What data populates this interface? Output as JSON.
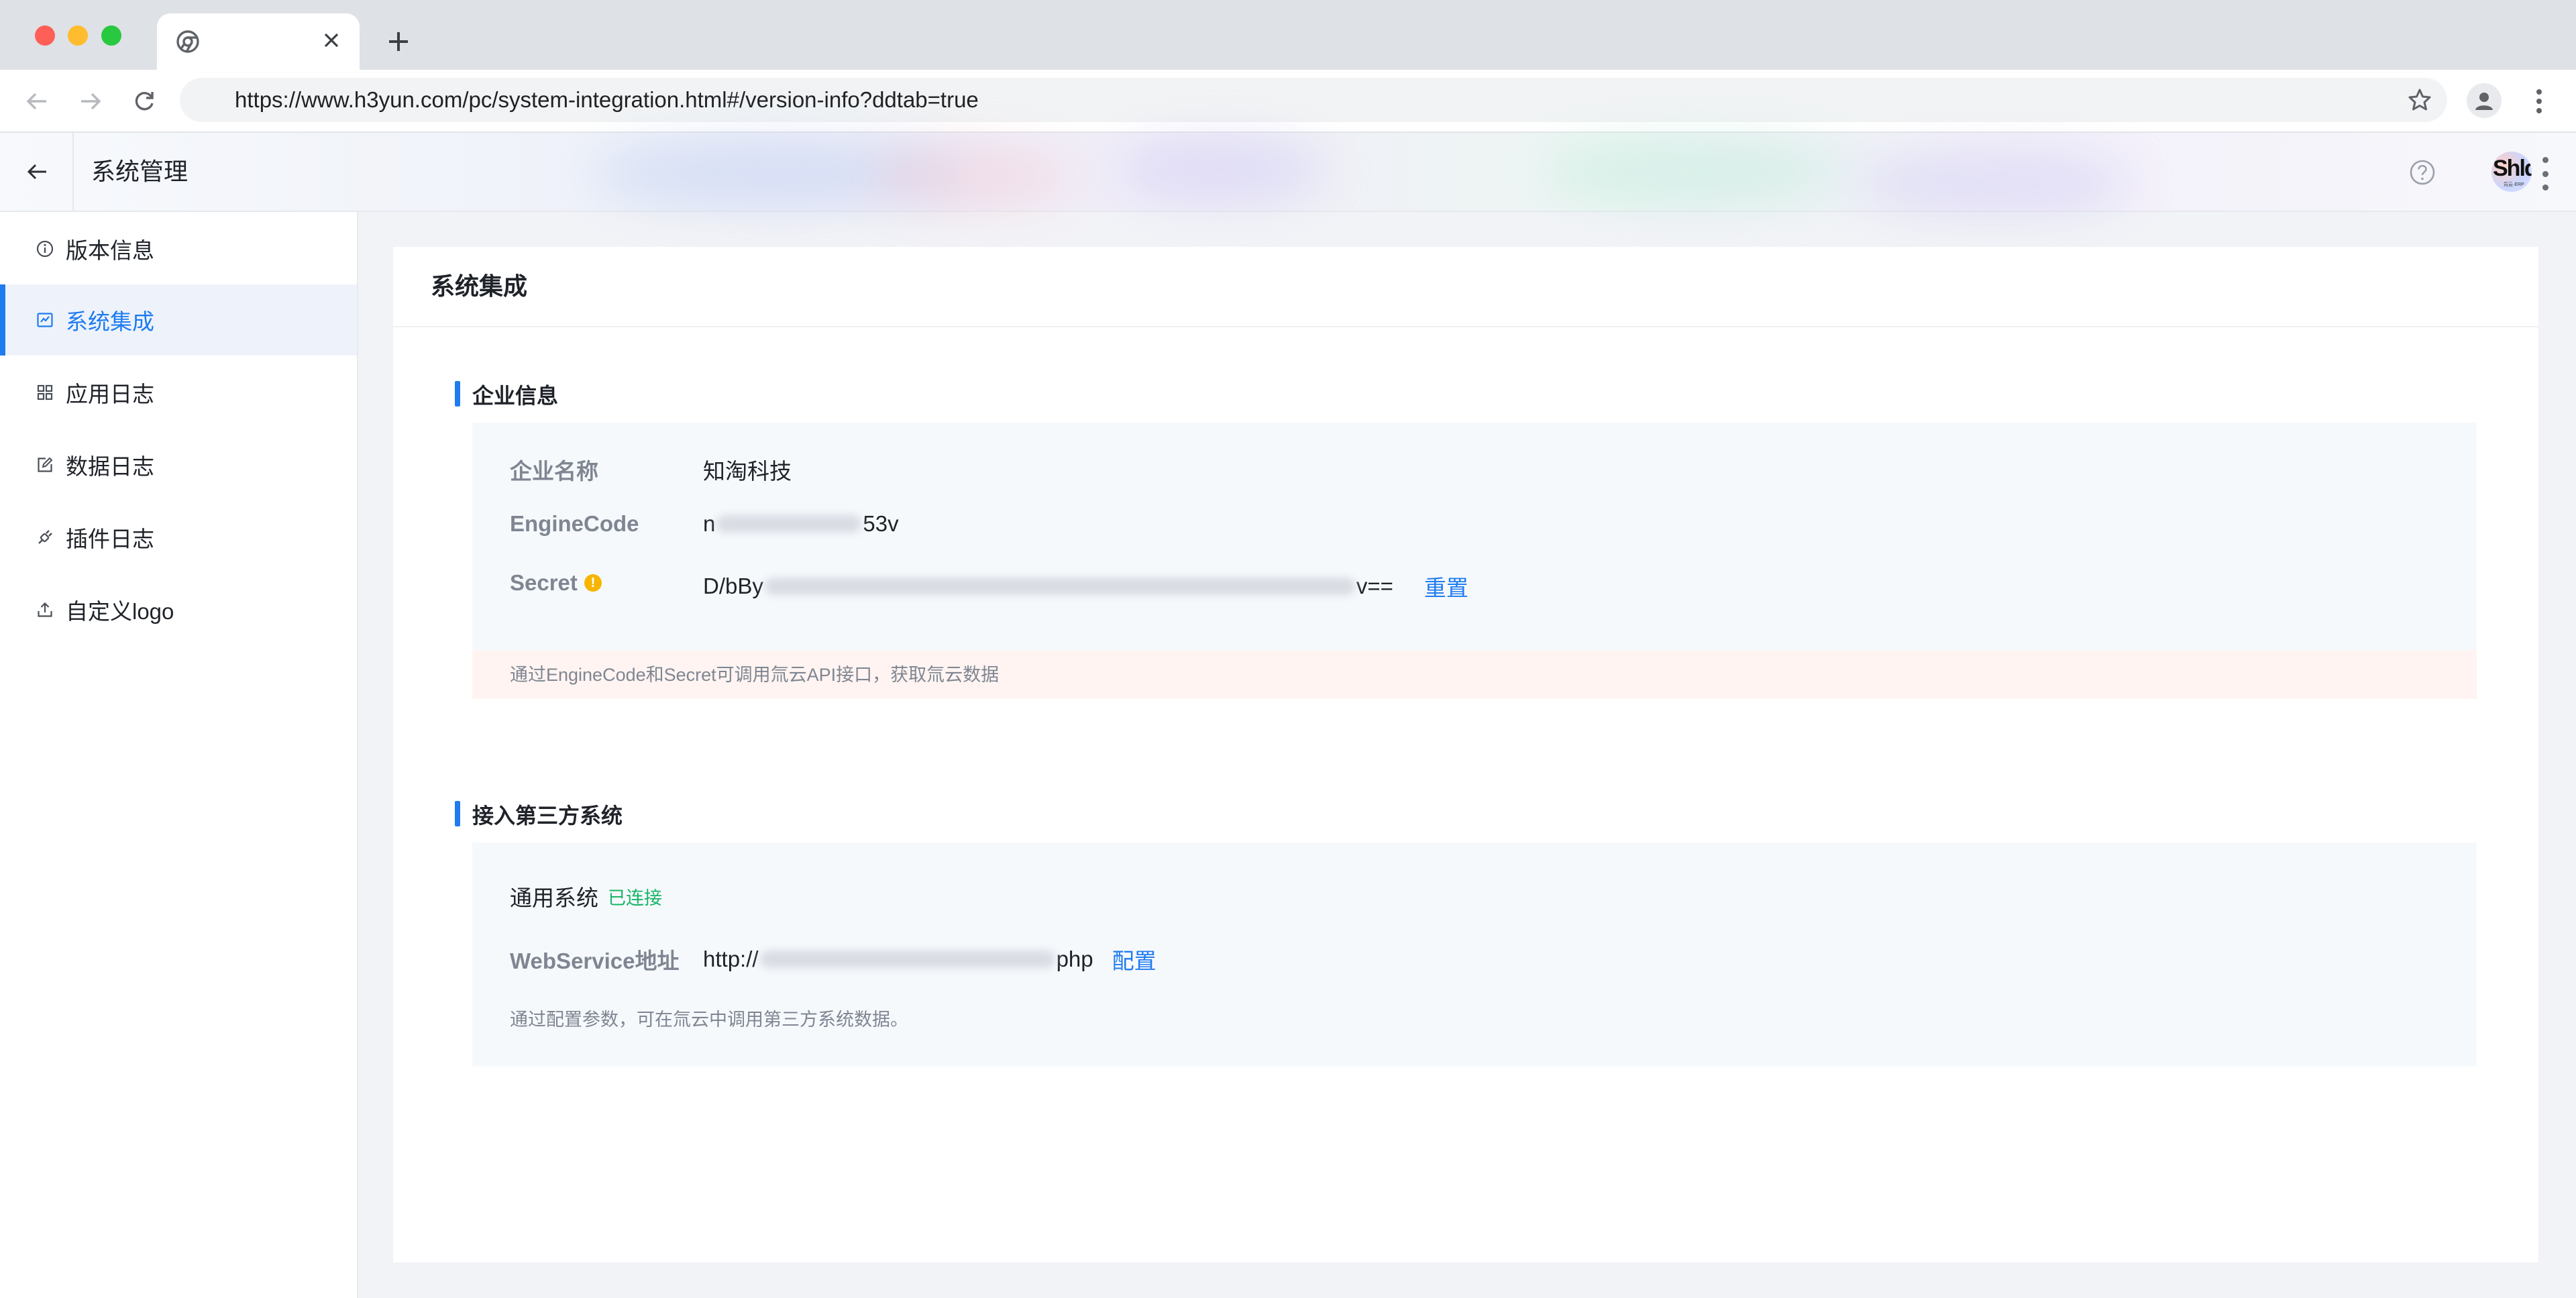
{
  "browser": {
    "url": "https://www.h3yun.com/pc/system-integration.html#/version-info?ddtab=true"
  },
  "header": {
    "title": "系统管理",
    "avatar_text": "Shld",
    "avatar_subtext": "氚云·ERP"
  },
  "sidebar": {
    "items": [
      {
        "label": "版本信息",
        "icon": "info-circle-icon",
        "active": false
      },
      {
        "label": "系统集成",
        "icon": "integration-icon",
        "active": true
      },
      {
        "label": "应用日志",
        "icon": "grid-icon",
        "active": false
      },
      {
        "label": "数据日志",
        "icon": "edit-doc-icon",
        "active": false
      },
      {
        "label": "插件日志",
        "icon": "plugin-icon",
        "active": false
      },
      {
        "label": "自定义logo",
        "icon": "upload-icon",
        "active": false
      }
    ]
  },
  "main": {
    "title": "系统集成",
    "enterprise": {
      "section_title": "企业信息",
      "name_label": "企业名称",
      "name_value": "知淘科技",
      "engine_label": "EngineCode",
      "engine_prefix": "n",
      "engine_suffix": "53v",
      "secret_label": "Secret",
      "secret_prefix": "D/bBy",
      "secret_suffix": "v==",
      "reset_label": "重置",
      "tip": "通过EngineCode和Secret可调用氚云API接口，获取氚云数据"
    },
    "third_party": {
      "section_title": "接入第三方系统",
      "system_label": "通用系统",
      "status": "已连接",
      "webservice_label": "WebService地址",
      "webservice_prefix": "http://",
      "webservice_suffix": "php",
      "config_label": "配置",
      "note": "通过配置参数，可在氚云中调用第三方系统数据。"
    }
  },
  "colors": {
    "accent": "#1f7cf0",
    "success": "#18b566",
    "warning": "#f7b500"
  }
}
